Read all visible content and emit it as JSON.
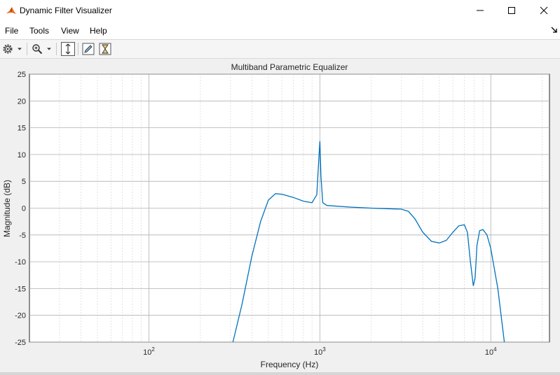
{
  "window": {
    "title": "Dynamic Filter Visualizer",
    "minimize_icon": "minimize-icon",
    "maximize_icon": "maximize-icon",
    "close_icon": "close-icon"
  },
  "menu": {
    "items": [
      "File",
      "Tools",
      "View",
      "Help"
    ]
  },
  "toolbar": {
    "icons": [
      "gear-icon",
      "chevron-down-icon",
      "zoom-in-icon",
      "chevron-down-icon",
      "fit-height-icon",
      "pencil-icon",
      "hourglass-icon"
    ]
  },
  "colors": {
    "line": "#0072bd",
    "grid": "#b0b0b0"
  },
  "chart_data": {
    "type": "line",
    "title": "Multiband Parametric Equalizer",
    "xlabel": "Frequency (Hz)",
    "ylabel": "Magnitude (dB)",
    "xscale": "log",
    "xlim": [
      20,
      22050
    ],
    "ylim": [
      -25,
      25
    ],
    "yticks": [
      -25,
      -20,
      -15,
      -10,
      -5,
      0,
      5,
      10,
      15,
      20,
      25
    ],
    "xtick_base": "10",
    "xtick_exponents": [
      "2",
      "3",
      "4"
    ],
    "xticks": [
      100,
      1000,
      10000
    ],
    "grid": true,
    "minor_grid": true,
    "series": [
      {
        "x": [
          310,
          350,
          400,
          450,
          500,
          550,
          600,
          700,
          800,
          900,
          960,
          985,
          1000,
          1015,
          1040,
          1100,
          1500,
          2000,
          2500,
          3000,
          3300,
          3600,
          4000,
          4500,
          5000,
          5500,
          6000,
          6500,
          7000,
          7300,
          7600,
          7900,
          8100,
          8300,
          8600,
          9000,
          9500,
          10000,
          11000,
          12000
        ],
        "y": [
          -25,
          -18,
          -9,
          -2.5,
          1.5,
          2.7,
          2.6,
          2.0,
          1.3,
          1.0,
          2.5,
          9.0,
          12.5,
          6.0,
          1.0,
          0.5,
          0.2,
          0.0,
          -0.1,
          -0.2,
          -0.6,
          -2.0,
          -4.5,
          -6.2,
          -6.5,
          -6.0,
          -4.5,
          -3.3,
          -3.1,
          -4.5,
          -10.0,
          -14.5,
          -13.0,
          -7.0,
          -4.2,
          -4.0,
          -5.0,
          -7.5,
          -15.0,
          -25
        ]
      }
    ]
  }
}
